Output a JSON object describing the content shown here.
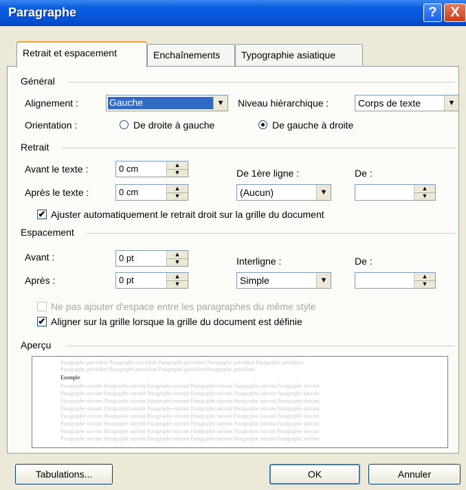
{
  "window": {
    "title": "Paragraphe",
    "help_button": "?",
    "close_button": "X"
  },
  "tabs": [
    {
      "label": "Retrait et espacement",
      "active": true
    },
    {
      "label": "Enchaînements",
      "active": false
    },
    {
      "label": "Typographie asiatique",
      "active": false
    }
  ],
  "general": {
    "section_label": "Général",
    "alignment_label": "Alignement :",
    "alignment_value": "Gauche",
    "outline_label": "Niveau hiérarchique :",
    "outline_value": "Corps de texte",
    "orientation_label": "Orientation :",
    "orientation_rtl": "De droite à gauche",
    "orientation_ltr": "De gauche à droite",
    "orientation_selected": "ltr"
  },
  "indent": {
    "section_label": "Retrait",
    "before_label": "Avant le texte :",
    "before_value": "0 cm",
    "after_label": "Après le texte :",
    "after_value": "0 cm",
    "special_label": "De 1ère ligne :",
    "special_value": "(Aucun)",
    "by_label": "De :",
    "by_value": "",
    "auto_adjust_label": "Ajuster automatiquement le retrait droit sur la grille du document",
    "auto_adjust_checked": true
  },
  "spacing": {
    "section_label": "Espacement",
    "before_label": "Avant :",
    "before_value": "0 pt",
    "after_label": "Après :",
    "after_value": "0 pt",
    "line_label": "Interligne :",
    "line_value": "Simple",
    "at_label": "De :",
    "at_value": "",
    "no_space_label": "Ne pas ajouter d'espace entre les paragraphes du même style",
    "no_space_checked": false,
    "snap_grid_label": "Aligner sur la grille lorsque la grille du document est définie",
    "snap_grid_checked": true
  },
  "preview": {
    "section_label": "Aperçu",
    "previous_lines": [
      "Paragraphe précédent Paragraphe précédent Paragraphe précédent Paragraphe précédent Paragraphe précédent",
      "Paragraphe précédent Paragraphe précédent Paragraphe précédent Paragraphe précédent"
    ],
    "example_line": "Exemple",
    "following_lines": [
      "Paragraphe suivant Paragraphe suivant Paragraphe suivant Paragraphe suivant Paragraphe suivant Paragraphe suivant",
      "Paragraphe suivant Paragraphe suivant Paragraphe suivant Paragraphe suivant Paragraphe suivant Paragraphe suivant",
      "Paragraphe suivant Paragraphe suivant Paragraphe suivant Paragraphe suivant Paragraphe suivant Paragraphe suivant",
      "Paragraphe suivant Paragraphe suivant Paragraphe suivant Paragraphe suivant Paragraphe suivant Paragraphe suivant",
      "Paragraphe suivant Paragraphe suivant Paragraphe suivant Paragraphe suivant Paragraphe suivant Paragraphe suivant",
      "Paragraphe suivant Paragraphe suivant Paragraphe suivant Paragraphe suivant Paragraphe suivant Paragraphe suivant",
      "Paragraphe suivant Paragraphe suivant Paragraphe suivant Paragraphe suivant Paragraphe suivant Paragraphe suivant",
      "Paragraphe suivant Paragraphe suivant Paragraphe suivant Paragraphe suivant Paragraphe suivant Paragraphe suivant"
    ]
  },
  "footer": {
    "tabs_button": "Tabulations...",
    "ok_button": "OK",
    "cancel_button": "Annuler"
  },
  "colors": {
    "title_bar": "#0554d8",
    "dialog_bg": "#ece9d8",
    "selection": "#316ac5",
    "active_tab_accent": "#f2a12c"
  }
}
